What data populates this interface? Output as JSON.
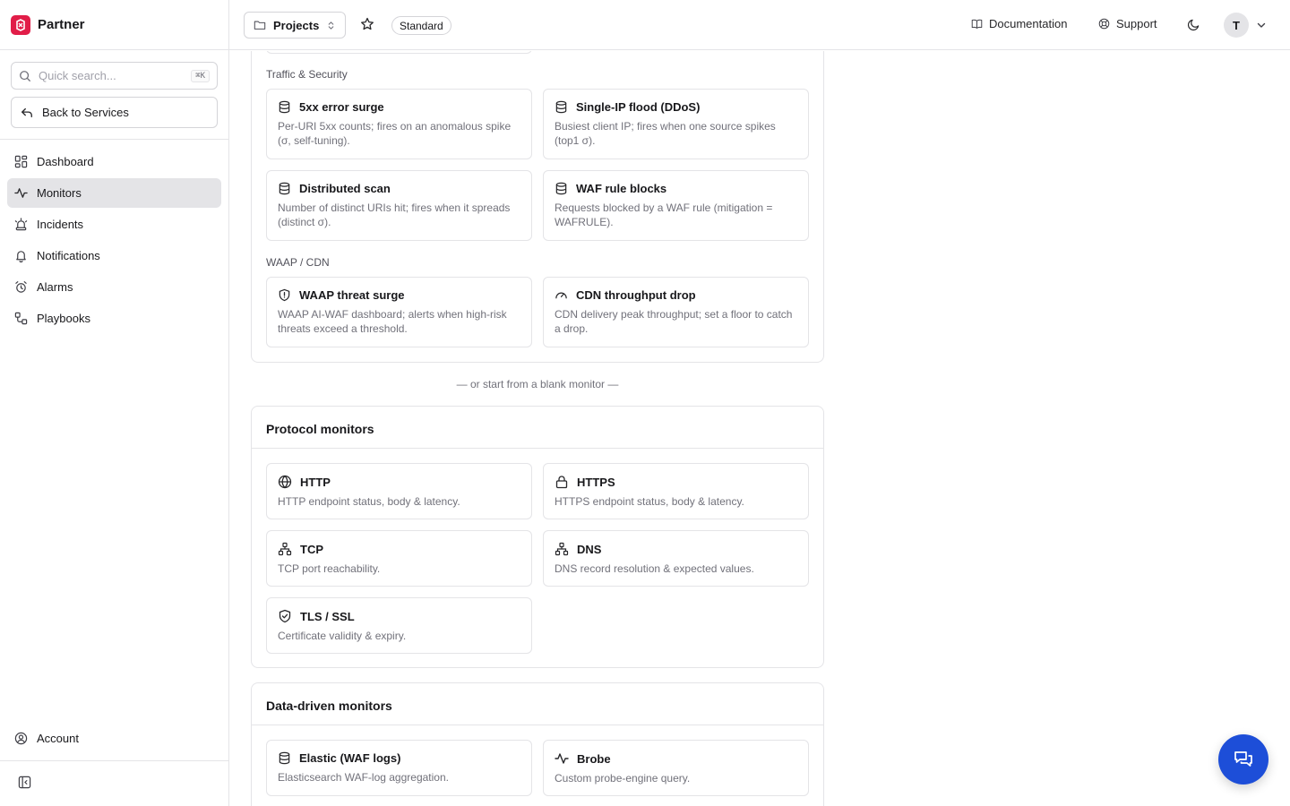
{
  "brand": {
    "name": "Partner",
    "color": "#e11d48"
  },
  "sidebar": {
    "search_placeholder": "Quick search...",
    "search_shortcut": "⌘K",
    "back_label": "Back to Services",
    "items": [
      {
        "label": "Dashboard",
        "icon": "dashboard-icon",
        "active": false
      },
      {
        "label": "Monitors",
        "icon": "activity-icon",
        "active": true
      },
      {
        "label": "Incidents",
        "icon": "siren-icon",
        "active": false
      },
      {
        "label": "Notifications",
        "icon": "bell-icon",
        "active": false
      },
      {
        "label": "Alarms",
        "icon": "alarm-clock-icon",
        "active": false
      },
      {
        "label": "Playbooks",
        "icon": "workflow-icon",
        "active": false
      }
    ],
    "account_label": "Account"
  },
  "header": {
    "projects_label": "Projects",
    "plan_badge": "Standard",
    "documentation_label": "Documentation",
    "support_label": "Support",
    "avatar_initial": "T"
  },
  "templates": {
    "traffic_group_label": "Traffic & Security",
    "traffic_cards": [
      {
        "title": "5xx error surge",
        "desc": "Per-URI 5xx counts; fires on an anomalous spike (σ, self-tuning).",
        "icon": "database-icon"
      },
      {
        "title": "Single-IP flood (DDoS)",
        "desc": "Busiest client IP; fires when one source spikes (top1 σ).",
        "icon": "database-icon"
      },
      {
        "title": "Distributed scan",
        "desc": "Number of distinct URIs hit; fires when it spreads (distinct σ).",
        "icon": "database-icon"
      },
      {
        "title": "WAF rule blocks",
        "desc": "Requests blocked by a WAF rule (mitigation = WAFRULE).",
        "icon": "database-icon"
      }
    ],
    "waap_group_label": "WAAP / CDN",
    "waap_cards": [
      {
        "title": "WAAP threat surge",
        "desc": "WAAP AI-WAF dashboard; alerts when high-risk threats exceed a threshold.",
        "icon": "shield-icon"
      },
      {
        "title": "CDN throughput drop",
        "desc": "CDN delivery peak throughput; set a floor to catch a drop.",
        "icon": "gauge-icon"
      }
    ]
  },
  "blank_separator": "— or start from a blank monitor —",
  "protocol": {
    "title": "Protocol monitors",
    "cards": [
      {
        "title": "HTTP",
        "desc": "HTTP endpoint status, body & latency.",
        "icon": "globe-icon"
      },
      {
        "title": "HTTPS",
        "desc": "HTTPS endpoint status, body & latency.",
        "icon": "lock-icon"
      },
      {
        "title": "TCP",
        "desc": "TCP port reachability.",
        "icon": "network-icon"
      },
      {
        "title": "DNS",
        "desc": "DNS record resolution & expected values.",
        "icon": "network-icon"
      },
      {
        "title": "TLS / SSL",
        "desc": "Certificate validity & expiry.",
        "icon": "shield-check-icon"
      }
    ]
  },
  "data_driven": {
    "title": "Data-driven monitors",
    "cards": [
      {
        "title": "Elastic (WAF logs)",
        "desc": "Elasticsearch WAF-log aggregation.",
        "icon": "database-icon"
      },
      {
        "title": "Brobe",
        "desc": "Custom probe-engine query.",
        "icon": "activity-icon"
      }
    ]
  },
  "colors": {
    "accent": "#1d4ed8",
    "active_nav": "#e4e4e7",
    "border": "#e4e4e7"
  }
}
